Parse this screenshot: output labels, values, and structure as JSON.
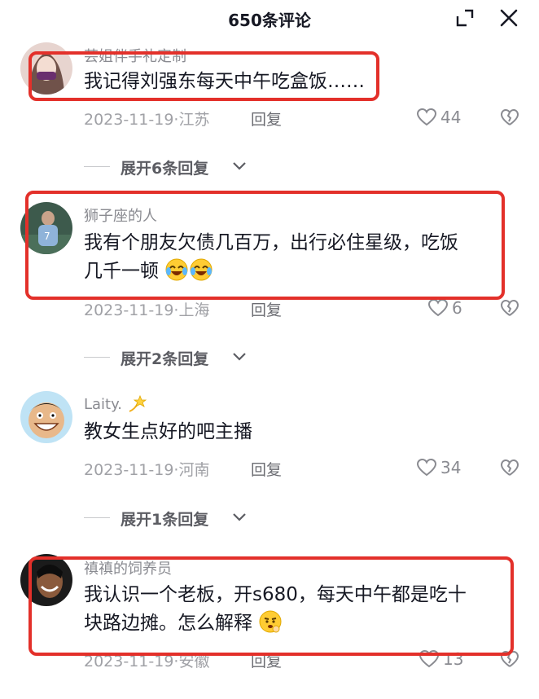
{
  "header": {
    "title": "650条评论",
    "expand_icon": "expand-icon",
    "close_icon": "close-icon"
  },
  "comments": [
    {
      "username": "芸姐伴手礼定制",
      "lines": [
        "我记得刘强东每天中午吃盒饭……"
      ],
      "date": "2023-11-19",
      "location": "江苏",
      "reply_label": "回复",
      "likes": "44",
      "expand_label": "展开6条回复"
    },
    {
      "username": "狮子座的人",
      "lines": [
        "我有个朋友欠债几百万，出行必住星级，吃饭",
        "几千一顿"
      ],
      "emojis": [
        "laughing-crying-emoji",
        "laughing-crying-emoji"
      ],
      "date": "2023-11-19",
      "location": "上海",
      "reply_label": "回复",
      "likes": "6",
      "expand_label": "展开2条回复"
    },
    {
      "username": "Laity.",
      "username_emoji": "dizzy-star-emoji",
      "lines": [
        "教女生点好的吧主播"
      ],
      "date": "2023-11-19",
      "location": "河南",
      "reply_label": "回复",
      "likes": "34",
      "expand_label": "展开1条回复"
    },
    {
      "username": "禛禛的饲养员",
      "lines": [
        "我认识一个老板，开s680，每天中午都是吃十",
        "块路边摊。怎么解释"
      ],
      "emojis": [
        "thinking-face-emoji"
      ],
      "date": "2023-11-19",
      "location": "安徽",
      "reply_label": "回复",
      "likes": "13"
    }
  ],
  "colors": {
    "highlight": "#e3302a",
    "text": "#161823",
    "muted": "#a0a1a6"
  }
}
